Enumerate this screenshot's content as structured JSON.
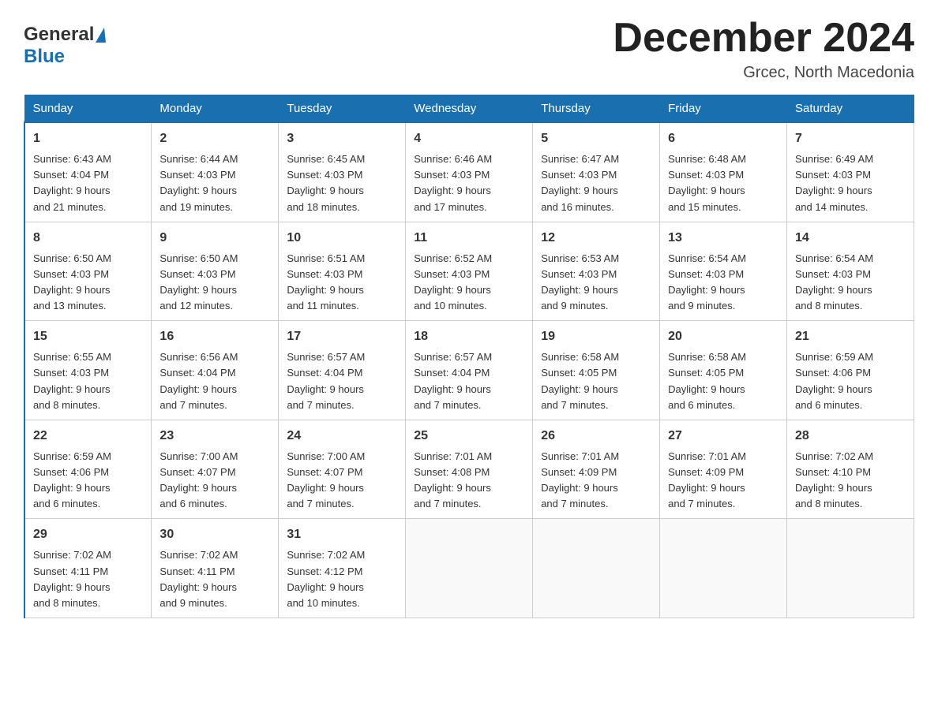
{
  "header": {
    "title": "December 2024",
    "location": "Grcec, North Macedonia",
    "logo_general": "General",
    "logo_blue": "Blue"
  },
  "days_of_week": [
    "Sunday",
    "Monday",
    "Tuesday",
    "Wednesday",
    "Thursday",
    "Friday",
    "Saturday"
  ],
  "weeks": [
    [
      {
        "day": "1",
        "sunrise": "6:43 AM",
        "sunset": "4:04 PM",
        "daylight": "9 hours and 21 minutes."
      },
      {
        "day": "2",
        "sunrise": "6:44 AM",
        "sunset": "4:03 PM",
        "daylight": "9 hours and 19 minutes."
      },
      {
        "day": "3",
        "sunrise": "6:45 AM",
        "sunset": "4:03 PM",
        "daylight": "9 hours and 18 minutes."
      },
      {
        "day": "4",
        "sunrise": "6:46 AM",
        "sunset": "4:03 PM",
        "daylight": "9 hours and 17 minutes."
      },
      {
        "day": "5",
        "sunrise": "6:47 AM",
        "sunset": "4:03 PM",
        "daylight": "9 hours and 16 minutes."
      },
      {
        "day": "6",
        "sunrise": "6:48 AM",
        "sunset": "4:03 PM",
        "daylight": "9 hours and 15 minutes."
      },
      {
        "day": "7",
        "sunrise": "6:49 AM",
        "sunset": "4:03 PM",
        "daylight": "9 hours and 14 minutes."
      }
    ],
    [
      {
        "day": "8",
        "sunrise": "6:50 AM",
        "sunset": "4:03 PM",
        "daylight": "9 hours and 13 minutes."
      },
      {
        "day": "9",
        "sunrise": "6:50 AM",
        "sunset": "4:03 PM",
        "daylight": "9 hours and 12 minutes."
      },
      {
        "day": "10",
        "sunrise": "6:51 AM",
        "sunset": "4:03 PM",
        "daylight": "9 hours and 11 minutes."
      },
      {
        "day": "11",
        "sunrise": "6:52 AM",
        "sunset": "4:03 PM",
        "daylight": "9 hours and 10 minutes."
      },
      {
        "day": "12",
        "sunrise": "6:53 AM",
        "sunset": "4:03 PM",
        "daylight": "9 hours and 9 minutes."
      },
      {
        "day": "13",
        "sunrise": "6:54 AM",
        "sunset": "4:03 PM",
        "daylight": "9 hours and 9 minutes."
      },
      {
        "day": "14",
        "sunrise": "6:54 AM",
        "sunset": "4:03 PM",
        "daylight": "9 hours and 8 minutes."
      }
    ],
    [
      {
        "day": "15",
        "sunrise": "6:55 AM",
        "sunset": "4:03 PM",
        "daylight": "9 hours and 8 minutes."
      },
      {
        "day": "16",
        "sunrise": "6:56 AM",
        "sunset": "4:04 PM",
        "daylight": "9 hours and 7 minutes."
      },
      {
        "day": "17",
        "sunrise": "6:57 AM",
        "sunset": "4:04 PM",
        "daylight": "9 hours and 7 minutes."
      },
      {
        "day": "18",
        "sunrise": "6:57 AM",
        "sunset": "4:04 PM",
        "daylight": "9 hours and 7 minutes."
      },
      {
        "day": "19",
        "sunrise": "6:58 AM",
        "sunset": "4:05 PM",
        "daylight": "9 hours and 7 minutes."
      },
      {
        "day": "20",
        "sunrise": "6:58 AM",
        "sunset": "4:05 PM",
        "daylight": "9 hours and 6 minutes."
      },
      {
        "day": "21",
        "sunrise": "6:59 AM",
        "sunset": "4:06 PM",
        "daylight": "9 hours and 6 minutes."
      }
    ],
    [
      {
        "day": "22",
        "sunrise": "6:59 AM",
        "sunset": "4:06 PM",
        "daylight": "9 hours and 6 minutes."
      },
      {
        "day": "23",
        "sunrise": "7:00 AM",
        "sunset": "4:07 PM",
        "daylight": "9 hours and 6 minutes."
      },
      {
        "day": "24",
        "sunrise": "7:00 AM",
        "sunset": "4:07 PM",
        "daylight": "9 hours and 7 minutes."
      },
      {
        "day": "25",
        "sunrise": "7:01 AM",
        "sunset": "4:08 PM",
        "daylight": "9 hours and 7 minutes."
      },
      {
        "day": "26",
        "sunrise": "7:01 AM",
        "sunset": "4:09 PM",
        "daylight": "9 hours and 7 minutes."
      },
      {
        "day": "27",
        "sunrise": "7:01 AM",
        "sunset": "4:09 PM",
        "daylight": "9 hours and 7 minutes."
      },
      {
        "day": "28",
        "sunrise": "7:02 AM",
        "sunset": "4:10 PM",
        "daylight": "9 hours and 8 minutes."
      }
    ],
    [
      {
        "day": "29",
        "sunrise": "7:02 AM",
        "sunset": "4:11 PM",
        "daylight": "9 hours and 8 minutes."
      },
      {
        "day": "30",
        "sunrise": "7:02 AM",
        "sunset": "4:11 PM",
        "daylight": "9 hours and 9 minutes."
      },
      {
        "day": "31",
        "sunrise": "7:02 AM",
        "sunset": "4:12 PM",
        "daylight": "9 hours and 10 minutes."
      },
      null,
      null,
      null,
      null
    ]
  ],
  "labels": {
    "sunrise": "Sunrise:",
    "sunset": "Sunset:",
    "daylight": "Daylight:"
  }
}
